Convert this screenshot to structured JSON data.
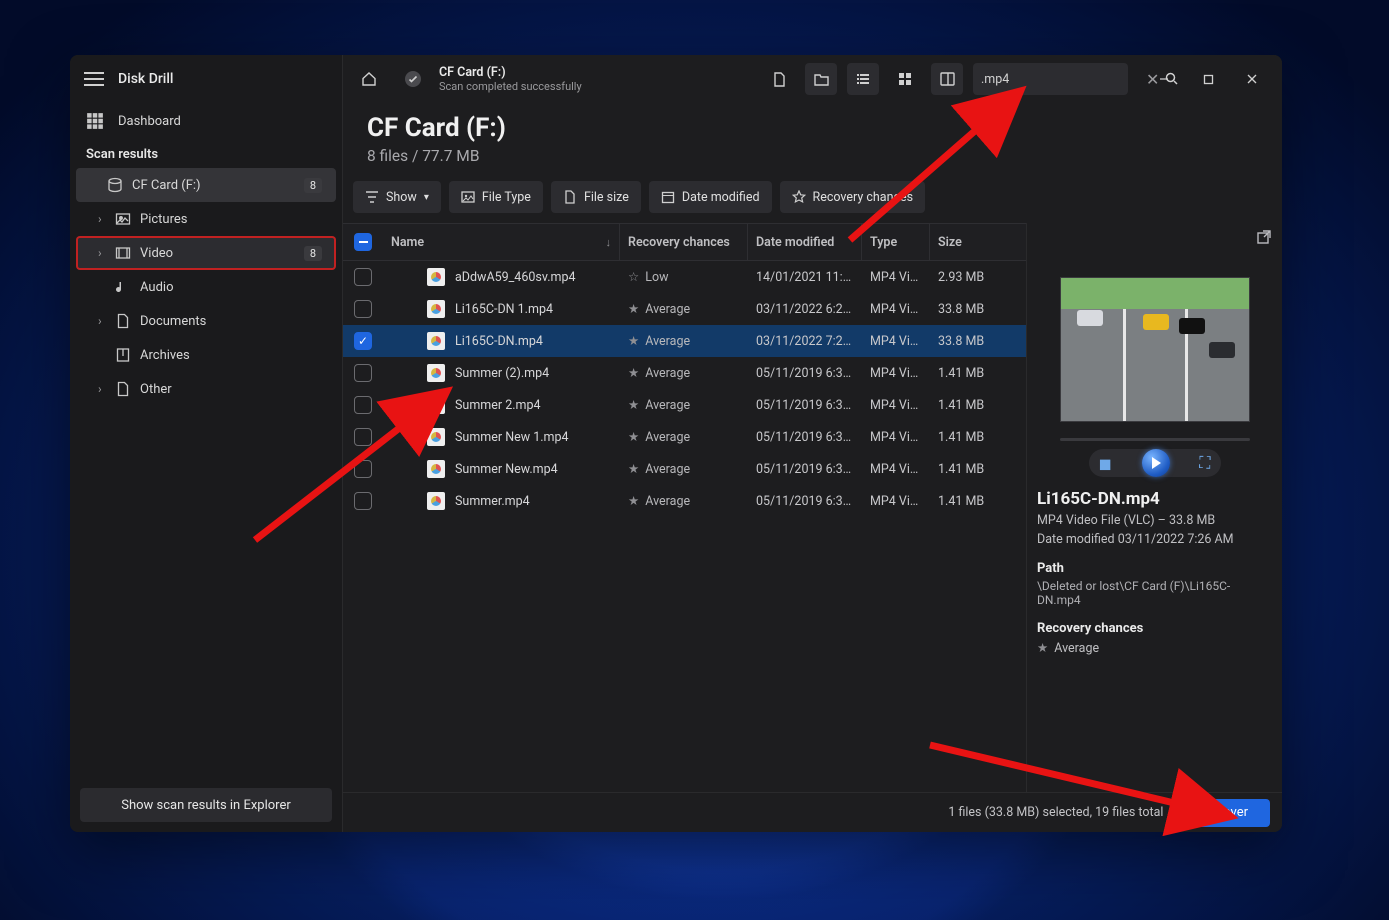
{
  "app": {
    "title": "Disk Drill"
  },
  "sidebar": {
    "dashboard": "Dashboard",
    "section": "Scan results",
    "items": [
      {
        "label": "CF Card (F:)",
        "badge": "8",
        "icon": "drive",
        "active": true,
        "indent": 0
      },
      {
        "label": "Pictures",
        "icon": "picture",
        "expandable": true,
        "indent": 1
      },
      {
        "label": "Video",
        "badge": "8",
        "icon": "video",
        "expandable": true,
        "indent": 1,
        "highlight": true
      },
      {
        "label": "Audio",
        "icon": "audio",
        "indent": 1
      },
      {
        "label": "Documents",
        "icon": "document",
        "expandable": true,
        "indent": 1
      },
      {
        "label": "Archives",
        "icon": "archive",
        "indent": 1
      },
      {
        "label": "Other",
        "icon": "other",
        "expandable": true,
        "indent": 1
      }
    ],
    "footer_btn": "Show scan results in Explorer"
  },
  "topbar": {
    "breadcrumb": "CF Card (F:)",
    "status": "Scan completed successfully",
    "search_value": ".mp4"
  },
  "header": {
    "title": "CF Card (F:)",
    "subtitle": "8 files / 77.7 MB"
  },
  "filters": {
    "show": "Show",
    "filetype": "File Type",
    "filesize": "File size",
    "datemod": "Date modified",
    "recchance": "Recovery chances"
  },
  "columns": {
    "name": "Name",
    "recovery": "Recovery chances",
    "date": "Date modified",
    "type": "Type",
    "size": "Size"
  },
  "rows": [
    {
      "name": "aDdwA59_460sv.mp4",
      "recovery": "Low",
      "date": "14/01/2021 11:5…",
      "type": "MP4 Vi…",
      "size": "2.93 MB",
      "checked": false
    },
    {
      "name": "Li165C-DN 1.mp4",
      "recovery": "Average",
      "date": "03/11/2022 6:22…",
      "type": "MP4 Vi…",
      "size": "33.8 MB",
      "checked": false
    },
    {
      "name": "Li165C-DN.mp4",
      "recovery": "Average",
      "date": "03/11/2022 7:26…",
      "type": "MP4 Vi…",
      "size": "33.8 MB",
      "checked": true,
      "selected": true
    },
    {
      "name": "Summer (2).mp4",
      "recovery": "Average",
      "date": "05/11/2019 6:38…",
      "type": "MP4 Vi…",
      "size": "1.41 MB",
      "checked": false
    },
    {
      "name": "Summer 2.mp4",
      "recovery": "Average",
      "date": "05/11/2019 6:38…",
      "type": "MP4 Vi…",
      "size": "1.41 MB",
      "checked": false
    },
    {
      "name": "Summer New 1.mp4",
      "recovery": "Average",
      "date": "05/11/2019 6:38…",
      "type": "MP4 Vi…",
      "size": "1.41 MB",
      "checked": false
    },
    {
      "name": "Summer New.mp4",
      "recovery": "Average",
      "date": "05/11/2019 6:38…",
      "type": "MP4 Vi…",
      "size": "1.41 MB",
      "checked": false
    },
    {
      "name": "Summer.mp4",
      "recovery": "Average",
      "date": "05/11/2019 6:38…",
      "type": "MP4 Vi…",
      "size": "1.41 MB",
      "checked": false
    }
  ],
  "preview": {
    "name": "Li165C-DN.mp4",
    "meta1": "MP4 Video File (VLC) – 33.8 MB",
    "meta2": "Date modified 03/11/2022 7:26 AM",
    "path_h": "Path",
    "path_v": "\\Deleted or lost\\CF Card (F)\\Li165C-DN.mp4",
    "rc_h": "Recovery chances",
    "rc_v": "Average"
  },
  "status": {
    "text": "1 files (33.8 MB) selected, 19 files total",
    "recover": "Recover"
  }
}
